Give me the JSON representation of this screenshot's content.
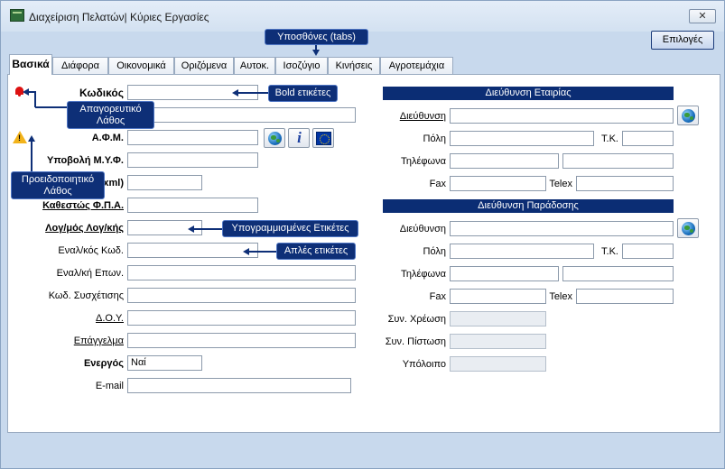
{
  "window": {
    "title": "Διαχείριση Πελατών| Κύριες Εργασίες",
    "close_label": "✕",
    "options_label": "Επιλογές"
  },
  "tabs": [
    "Βασικά",
    "Διάφορα",
    "Οικονομικά",
    "Οριζόμενα",
    "Αυτοκ.",
    "Ισοζύγιο",
    "Κινήσεις",
    "Αγροτεμάχια"
  ],
  "left_form": {
    "code_label": "Κωδικός",
    "afm_label": "Α.Φ.Μ.",
    "myf_label": "Υποβολή Μ.Υ.Φ.",
    "xml_label": "xml)",
    "vat_label": "Καθεστώς Φ.Π.Α.",
    "account_label": "Λογ/μός Λογ/κής",
    "alt_code_label": "Εναλ/κός Κωδ.",
    "alt_name_label": "Εναλ/κή Επων.",
    "relation_code_label": "Κωδ. Συσχέτισης",
    "doy_label": "Δ.Ο.Υ.",
    "profession_label": "Επάγγελμα",
    "active_label": "Ενεργός",
    "active_value": "Ναί",
    "email_label": "E-mail"
  },
  "company_address": {
    "header": "Διεύθυνση Εταιρίας",
    "address_label": "Διεύθυνση",
    "city_label": "Πόλη",
    "zip_label": "Τ.Κ.",
    "phones_label": "Τηλέφωνα",
    "fax_label": "Fax",
    "telex_label": "Telex"
  },
  "delivery_address": {
    "header": "Διεύθυνση Παράδοσης",
    "address_label": "Διεύθυνση",
    "city_label": "Πόλη",
    "zip_label": "Τ.Κ.",
    "phones_label": "Τηλέφωνα",
    "fax_label": "Fax",
    "telex_label": "Telex"
  },
  "balances": {
    "debit_label": "Συν. Χρέωση",
    "credit_label": "Συν. Πίστωση",
    "balance_label": "Υπόλοιπο"
  },
  "callouts": {
    "tabs": "Υποσθόνες (tabs)",
    "bold": "Bold ετικέτες",
    "error": "Απαγορευτικό Λάθος",
    "warning": "Προειδοποιητικό Λάθος",
    "underlined": "Υπογραμμισμένες Ετικέτες",
    "plain": "Απλές ετικέτες"
  },
  "icons": {
    "app": "app-logo-icon",
    "error": "bell-icon",
    "warning": "warning-icon",
    "globe": "globe-icon",
    "info": "info-icon",
    "eu": "eu-flag-icon"
  },
  "colors": {
    "header_bg": "#0b2d74",
    "callout_bg": "#0e2f77",
    "window_bg": "#c8d9ed",
    "error": "#dd1111",
    "warning": "#f2b31b"
  }
}
